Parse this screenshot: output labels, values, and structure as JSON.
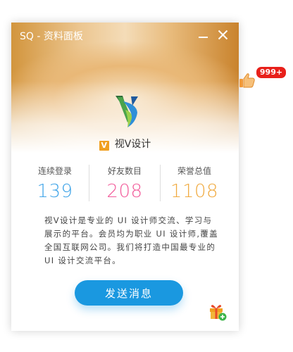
{
  "window": {
    "title": "SQ - 资料面板"
  },
  "brand": {
    "badge_letter": "V",
    "name": "视V设计"
  },
  "stats": [
    {
      "label": "连续登录",
      "value": "139",
      "color": "#3fa4e8"
    },
    {
      "label": "好友数目",
      "value": "208",
      "color": "#f25b9a"
    },
    {
      "label": "荣誉总值",
      "value": "1108",
      "color": "#f0a93e"
    }
  ],
  "description": "视V设计是专业的 UI 设计师交流、学习与展示的平台。会员均为职业 UI 设计师,覆盖全国互联网公司。我们将打造中国最专业的 UI 设计交流平台。",
  "actions": {
    "send_label": "发送消息"
  },
  "like": {
    "count": "999+"
  },
  "icons": {
    "minimize": "minimize-icon",
    "close": "close-icon",
    "logo": "brand-logo",
    "gift": "gift-icon",
    "thumb": "thumbs-up-icon"
  },
  "colors": {
    "accent": "#1a98e0",
    "badge": "#e8201a",
    "brand_badge": "#f0a020"
  }
}
